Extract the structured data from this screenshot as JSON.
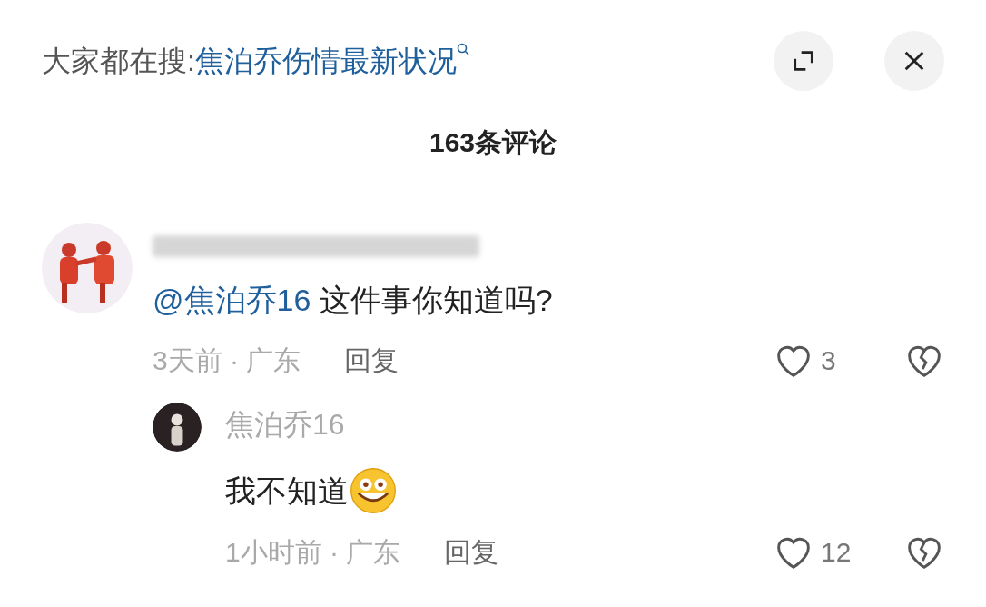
{
  "header": {
    "trending_label": "大家都在搜:",
    "trending_query": "焦泊乔伤情最新状况"
  },
  "comment_count": "163条评论",
  "comments": [
    {
      "author_blurred": true,
      "text_mention": "@焦泊乔16",
      "text": "这件事你知道吗?",
      "time_location": "3天前 · 广东",
      "reply": "回复",
      "likes": "3",
      "replies": [
        {
          "author": "焦泊乔16",
          "author_blurred": false,
          "text": "我不知道",
          "emoji": true,
          "time_location": "1小时前 · 广东",
          "reply": "回复",
          "likes": "12"
        }
      ]
    }
  ]
}
